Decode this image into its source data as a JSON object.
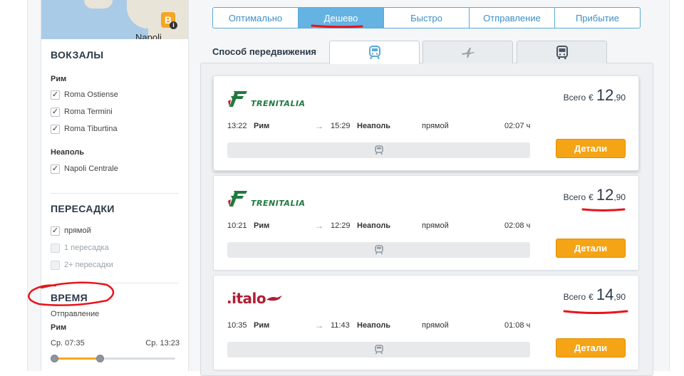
{
  "map": {
    "pin_letter": "B",
    "city_label": "Napoli",
    "info_glyph": "i"
  },
  "sidebar": {
    "stations": {
      "heading": "ВОКЗАЛЫ",
      "groups": [
        {
          "city": "Рим",
          "items": [
            {
              "label": "Roma Ostiense",
              "checked": true
            },
            {
              "label": "Roma Termini",
              "checked": true
            },
            {
              "label": "Roma Tiburtina",
              "checked": true
            }
          ]
        },
        {
          "city": "Неаполь",
          "items": [
            {
              "label": "Napoli Centrale",
              "checked": true
            }
          ]
        }
      ]
    },
    "transfers": {
      "heading": "ПЕРЕСАДКИ",
      "items": [
        {
          "label": "прямой",
          "checked": true
        },
        {
          "label": "1 пересадка",
          "checked": false
        },
        {
          "label": "2+ пересадки",
          "checked": false
        }
      ]
    },
    "time": {
      "heading": "ВРЕМЯ",
      "sub": "Отправление",
      "city": "Рим",
      "from": "Ср. 07:35",
      "to": "Ср. 13:23"
    }
  },
  "sort_tabs": [
    "Оптимально",
    "Дешево",
    "Быстро",
    "Отправление",
    "Прибытие"
  ],
  "sort_active": "Дешево",
  "mode": {
    "label": "Способ передвижения",
    "icons": [
      "train-icon",
      "plane-icon",
      "bus-icon"
    ],
    "active": "train-icon"
  },
  "price_label": "Всего",
  "currency": "€",
  "details_label": "Детали",
  "results": [
    {
      "carrier": "TRENITALIA",
      "price_int": "12",
      "price_dec": ",90",
      "dep_time": "13:22",
      "dep_city": "Рим",
      "arr_time": "15:29",
      "arr_city": "Неаполь",
      "type": "прямой",
      "duration": "02:07 ч"
    },
    {
      "carrier": "TRENITALIA",
      "price_int": "12",
      "price_dec": ",90",
      "dep_time": "10:21",
      "dep_city": "Рим",
      "arr_time": "12:29",
      "arr_city": "Неаполь",
      "type": "прямой",
      "duration": "02:08 ч"
    },
    {
      "carrier": ".italo",
      "price_int": "14",
      "price_dec": ",90",
      "dep_time": "10:35",
      "dep_city": "Рим",
      "arr_time": "11:43",
      "arr_city": "Неаполь",
      "type": "прямой",
      "duration": "01:08 ч"
    }
  ],
  "colors": {
    "accent_blue": "#65b3e3",
    "button_orange": "#f4a415",
    "annotation_red": "#e8141c",
    "trenitalia_green": "#1f7a3d",
    "italo_red": "#b01e35"
  }
}
